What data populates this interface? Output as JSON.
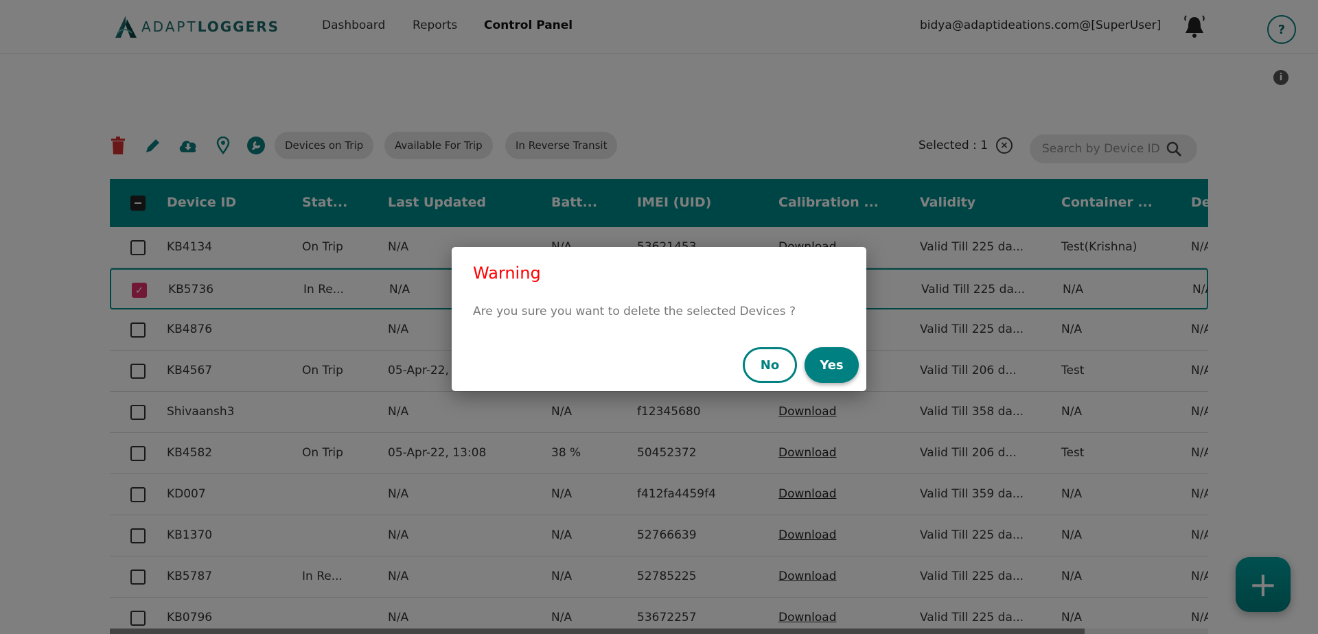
{
  "header": {
    "logo_text_light": "ADAPT",
    "logo_text_bold": "LOGGERS",
    "nav": [
      "Dashboard",
      "Reports",
      "Control Panel"
    ],
    "active_nav": "Control Panel",
    "user": "bidya@adaptideations.com@[SuperUser]",
    "help_label": "?",
    "info_label": "i"
  },
  "toolbar": {
    "icons": [
      "trash-icon",
      "pencil-icon",
      "cloud-download-icon",
      "map-pin-icon",
      "wrench-icon"
    ],
    "filters": [
      "Devices on Trip",
      "Available For Trip",
      "In Reverse Transit"
    ],
    "selected_label": "Selected : 1",
    "search_placeholder": "Search by Device ID"
  },
  "colors": {
    "teal": "#008a8a",
    "danger": "#d32f2f",
    "checkbox": "#e0306a",
    "warning": "#ff0000"
  },
  "table": {
    "columns": [
      "Device ID",
      "Stat...",
      "Last Updated",
      "Batt...",
      "IMEI (UID)",
      "Calibration ...",
      "Validity",
      "Container ...",
      "De"
    ],
    "rows": [
      {
        "checked": false,
        "cells": [
          "KB4134",
          "On Trip",
          "N/A",
          "N/A",
          "53621453",
          "Download",
          "Valid Till 225 da...",
          "Test(Krishna)",
          "N/A"
        ]
      },
      {
        "checked": true,
        "cells": [
          "KB5736",
          "In Re...",
          "N/A",
          "",
          "",
          "",
          "Valid Till 225 da...",
          "N/A",
          "N/A"
        ]
      },
      {
        "checked": false,
        "cells": [
          "KB4876",
          "",
          "N/A",
          "",
          "",
          "",
          "Valid Till 225 da...",
          "N/A",
          "N/A"
        ]
      },
      {
        "checked": false,
        "cells": [
          "KB4567",
          "On Trip",
          "05-Apr-22,",
          "",
          "",
          "",
          "Valid Till 206 d...",
          "Test",
          "N/A"
        ]
      },
      {
        "checked": false,
        "cells": [
          "Shivaansh3",
          "",
          "N/A",
          "N/A",
          "f12345680",
          "Download",
          "Valid Till 358 da...",
          "N/A",
          "N/A"
        ]
      },
      {
        "checked": false,
        "cells": [
          "KB4582",
          "On Trip",
          "05-Apr-22, 13:08",
          "38 %",
          "50452372",
          "Download",
          "Valid Till 206 d...",
          "Test",
          "N/A"
        ]
      },
      {
        "checked": false,
        "cells": [
          "KD007",
          "",
          "N/A",
          "N/A",
          "f412fa4459f4",
          "Download",
          "Valid Till 359 da...",
          "N/A",
          "N/A"
        ]
      },
      {
        "checked": false,
        "cells": [
          "KB1370",
          "",
          "N/A",
          "N/A",
          "52766639",
          "Download",
          "Valid Till 225 da...",
          "N/A",
          "N/A"
        ]
      },
      {
        "checked": false,
        "cells": [
          "KB5787",
          "In Re...",
          "N/A",
          "N/A",
          "52785225",
          "Download",
          "Valid Till 225 da...",
          "N/A",
          "N/A"
        ]
      },
      {
        "checked": false,
        "cells": [
          "KB0796",
          "",
          "N/A",
          "N/A",
          "53672257",
          "Download",
          "Valid Till 225 da...",
          "N/A",
          "N/A"
        ]
      }
    ]
  },
  "fab_label": "+",
  "modal": {
    "title": "Warning",
    "message": "Are you sure you want to delete the selected Devices ?",
    "no_label": "No",
    "yes_label": "Yes"
  }
}
